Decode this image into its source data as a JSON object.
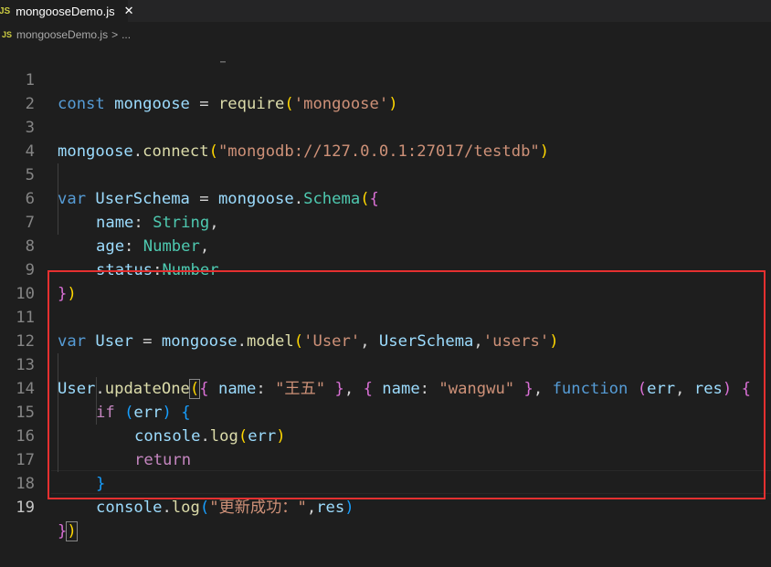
{
  "tab": {
    "icon_text": "JS",
    "label": "mongooseDemo.js",
    "close": "✕"
  },
  "breadcrumb": {
    "icon_text": "JS",
    "file": "mongooseDemo.js",
    "separator": ">",
    "ellipsis": "..."
  },
  "editor": {
    "line_numbers": [
      "1",
      "2",
      "3",
      "4",
      "5",
      "6",
      "7",
      "8",
      "9",
      "10",
      "11",
      "12",
      "13",
      "14",
      "15",
      "16",
      "17",
      "18",
      "19"
    ],
    "active_line": "19",
    "code": {
      "l1": {
        "const": "const",
        "name": "mongoose",
        "eq": " = ",
        "require": "require",
        "open": "(",
        "arg": "'mongoose'",
        "close": ")"
      },
      "l3": {
        "obj": "mongoose",
        "dot": ".",
        "method": "connect",
        "open": "(",
        "arg": "\"mongodb://127.0.0.1:27017/testdb\"",
        "close": ")"
      },
      "l5": {
        "var": "var",
        "name": "UserSchema",
        "eq": " = ",
        "obj": "mongoose",
        "dot": ".",
        "cls": "Schema",
        "open": "(",
        "brace": "{"
      },
      "l6": {
        "key": "name",
        "colon": ": ",
        "type": "String",
        "comma": ","
      },
      "l7": {
        "key": "age",
        "colon": ": ",
        "type": "Number",
        "comma": ","
      },
      "l8": {
        "key": "status",
        "colon": ":",
        "type": "Number"
      },
      "l9": {
        "brace": "}",
        "close": ")"
      },
      "l11": {
        "var": "var",
        "name": "User",
        "eq": " = ",
        "obj": "mongoose",
        "dot": ".",
        "method": "model",
        "open": "(",
        "arg1": "'User'",
        "comma1": ", ",
        "arg2": "UserSchema",
        "comma2": ",",
        "arg3": "'users'",
        "close": ")"
      },
      "l13": {
        "obj": "User",
        "dot": ".",
        "method": "updateOne",
        "open": "(",
        "b1": "{",
        "k1": " name",
        "c1": ": ",
        "v1": "\"王五\"",
        "b1c": " }",
        "comma1": ", ",
        "b2": "{",
        "k2": " name",
        "c2": ": ",
        "v2": "\"wangwu\"",
        "b2c": " }",
        "comma2": ", ",
        "fn": "function",
        "sp": " ",
        "po": "(",
        "p1": "err",
        "pc": ", ",
        "p2": "res",
        "pcl": ")",
        "sp2": " ",
        "b3": "{"
      },
      "l14": {
        "if": "if",
        "sp": " ",
        "open": "(",
        "arg": "err",
        "close": ")",
        "sp2": " ",
        "brace": "{"
      },
      "l15": {
        "obj": "console",
        "dot": ".",
        "method": "log",
        "open": "(",
        "arg": "err",
        "close": ")"
      },
      "l16": {
        "ret": "return"
      },
      "l17": {
        "brace": "}"
      },
      "l18": {
        "obj": "console",
        "dot": ".",
        "method": "log",
        "open": "(",
        "arg1": "\"更新成功：\"",
        "comma": ",",
        "arg2": "res",
        "close": ")"
      },
      "l19": {
        "brace": "}",
        "close": ")"
      }
    }
  },
  "colors": {
    "background": "#1e1e1e",
    "highlight_box": "#e53030",
    "keyword": "#569cd6",
    "string": "#ce9178",
    "function": "#dcdcaa",
    "variable": "#9cdcfe",
    "class": "#4ec9b0"
  }
}
